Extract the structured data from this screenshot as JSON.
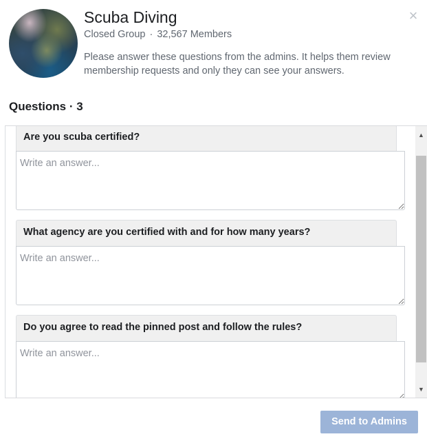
{
  "group": {
    "name": "Scuba Diving",
    "privacy": "Closed Group",
    "separator": "·",
    "members": "32,567 Members",
    "description": "Please answer these questions from the admins. It helps them review membership requests and only they can see your answers."
  },
  "close_icon": "×",
  "questions_heading": "Questions · 3",
  "questions": [
    {
      "label": "Are you scuba certified?",
      "placeholder": "Write an answer..."
    },
    {
      "label": "What agency are you certified with and for how many years?",
      "placeholder": "Write an answer..."
    },
    {
      "label": "Do you agree to read the pinned post and follow the rules?",
      "placeholder": "Write an answer..."
    }
  ],
  "scrollbar": {
    "up_icon": "▲",
    "down_icon": "▼"
  },
  "footer": {
    "send_label": "Send to Admins"
  },
  "colors": {
    "send_button_disabled": "#9cb4d8",
    "label_background": "#f0f0f0",
    "muted_text": "#606770"
  },
  "icons": {
    "avatar": "group-avatar-image",
    "close": "close-icon",
    "scroll_up": "scroll-up-arrow-icon",
    "scroll_down": "scroll-down-arrow-icon"
  }
}
